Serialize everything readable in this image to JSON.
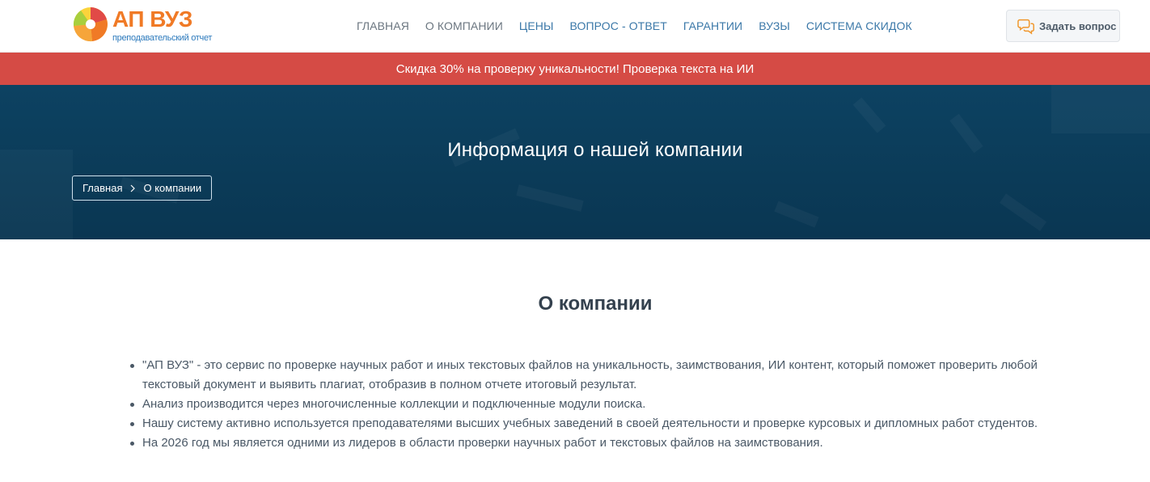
{
  "header": {
    "logo": {
      "title": "АП ВУЗ",
      "subtitle": "преподавательский отчет",
      "colors": [
        "#f07a26",
        "#a8cf3d",
        "#fbd33b",
        "#e14a47"
      ]
    },
    "nav": [
      {
        "label": "ГЛАВНАЯ"
      },
      {
        "label": "О КОМПАНИИ"
      },
      {
        "label": "ЦЕНЫ"
      },
      {
        "label": "ВОПРОС - ОТВЕТ"
      },
      {
        "label": "ГАРАНТИИ"
      },
      {
        "label": "ВУЗЫ"
      },
      {
        "label": "СИСТЕМА СКИДОК"
      }
    ],
    "ask_button": {
      "label": "Задать вопрос",
      "icon": "chat-bubbles-icon"
    }
  },
  "promo": {
    "text": "Скидка 30% на проверку уникальности! Проверка текста на ИИ",
    "color": "#d54b45"
  },
  "hero": {
    "title": "Информация о нашей компании",
    "breadcrumb": [
      {
        "label": "Главная"
      },
      {
        "label": "О компании"
      }
    ],
    "separator_icon": "chevron-right-icon"
  },
  "main": {
    "title": "О компании",
    "items": [
      {
        "text": "\"АП ВУЗ\" - это сервис по проверке научных работ и иных текстовых файлов на уникальность, заимствования, ИИ контент, который поможет проверить любой текстовый документ и выявить плагиат, отобразив в полном отчете итоговый результат."
      },
      {
        "text": "Анализ производится через многочисленные коллекции и подключенные модули поиска."
      },
      {
        "text": "Нашу систему активно используется преподавателями высших учебных заведений в своей деятельности и проверке курсовых и дипломных работ студентов."
      },
      {
        "text": "На 2026 год мы является одними из лидеров в области проверки научных работ и текстовых файлов на заимствования."
      }
    ]
  }
}
